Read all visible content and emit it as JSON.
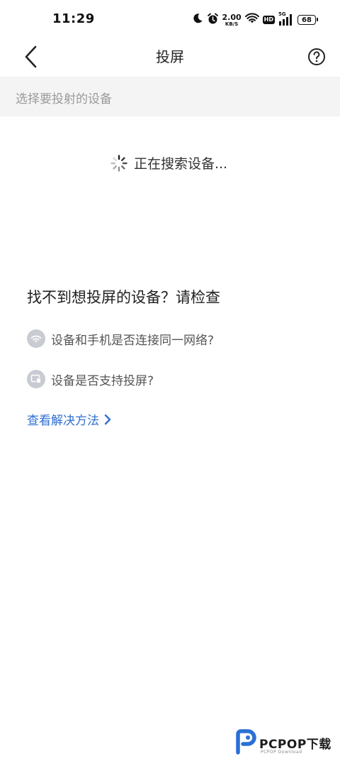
{
  "status_bar": {
    "time": "11:29",
    "net_speed_value": "2.00",
    "net_speed_unit": "KB/S",
    "hd_badge": "HD",
    "network_type": "5G",
    "battery_level": "68"
  },
  "nav": {
    "title": "投屏"
  },
  "section": {
    "header": "选择要投射的设备"
  },
  "searching": {
    "text": "正在搜索设备..."
  },
  "help": {
    "title": "找不到想投屏的设备？请检查",
    "items": [
      {
        "icon": "wifi-icon",
        "label": "设备和手机是否连接同一网络?"
      },
      {
        "icon": "cast-icon",
        "label": "设备是否支持投屏?"
      }
    ],
    "link": "查看解决方法"
  },
  "watermark": {
    "brand": "PCPOP下载",
    "sub": "PCPOP Download"
  },
  "colors": {
    "link": "#2f6fd0",
    "section_bg": "#f4f4f5",
    "hint_text": "#9a9a9a",
    "icon_bg": "#c8cbd2"
  }
}
